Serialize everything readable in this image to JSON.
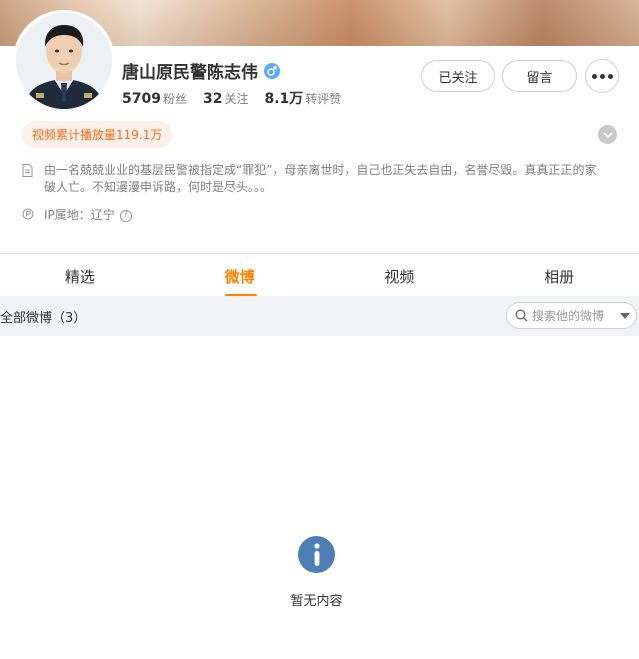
{
  "profile": {
    "name": "唐山原民警陈志伟",
    "gender": "male",
    "stats": [
      {
        "value": "5709",
        "label": "粉丝"
      },
      {
        "value": "32",
        "label": "关注"
      },
      {
        "value": "8.1万",
        "label": "转评赞"
      }
    ],
    "actions": {
      "follow_label": "已关注",
      "message_label": "留言"
    },
    "video_badge": "视频累计播放量119.1万",
    "bio": "由一名兢兢业业的基层民警被指定成“罪犯”，母亲离世时，自己也正失去自由，名誉尽毁。真真正正的家破人亡。不知漫漫申诉路，何时是尽头。。。",
    "ip_location": "IP属地：辽宁"
  },
  "tabs": [
    {
      "label": "精选",
      "active": false
    },
    {
      "label": "微博",
      "active": true
    },
    {
      "label": "视频",
      "active": false
    },
    {
      "label": "相册",
      "active": false
    }
  ],
  "filter": {
    "label": "全部微博（3）",
    "search_placeholder": "搜索他的微博"
  },
  "empty_state": {
    "text": "暂无内容"
  },
  "colors": {
    "accent": "#ff8200",
    "badge_text": "#ff6a1a",
    "badge_bg": "#fdf0e8",
    "info_icon": "#4c7fb6"
  }
}
